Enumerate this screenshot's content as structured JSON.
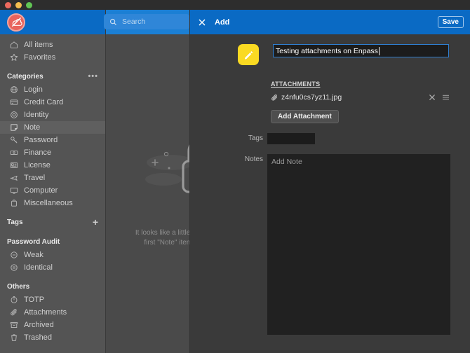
{
  "window": {
    "traffic_lights": [
      "close",
      "minimize",
      "zoom"
    ]
  },
  "search": {
    "placeholder": "Search"
  },
  "sidebar": {
    "logo_name": "enpass-logo",
    "top_items": [
      {
        "label": "All items",
        "icon": "home-icon"
      },
      {
        "label": "Favorites",
        "icon": "star-icon"
      }
    ],
    "categories_header": "Categories",
    "categories_menu": "•••",
    "categories": [
      {
        "label": "Login",
        "icon": "globe-icon",
        "active": false
      },
      {
        "label": "Credit Card",
        "icon": "credit-card-icon",
        "active": false
      },
      {
        "label": "Identity",
        "icon": "identity-icon",
        "active": false
      },
      {
        "label": "Note",
        "icon": "note-icon",
        "active": true
      },
      {
        "label": "Password",
        "icon": "key-icon",
        "active": false
      },
      {
        "label": "Finance",
        "icon": "finance-icon",
        "active": false
      },
      {
        "label": "License",
        "icon": "license-icon",
        "active": false
      },
      {
        "label": "Travel",
        "icon": "travel-icon",
        "active": false
      },
      {
        "label": "Computer",
        "icon": "monitor-icon",
        "active": false
      },
      {
        "label": "Miscellaneous",
        "icon": "briefcase-icon",
        "active": false
      }
    ],
    "tags_header": "Tags",
    "tags_add": "+",
    "password_audit_header": "Password Audit",
    "password_audit": [
      {
        "label": "Weak",
        "icon": "minus-circle-icon"
      },
      {
        "label": "Identical",
        "icon": "equals-circle-icon"
      }
    ],
    "others_header": "Others",
    "others": [
      {
        "label": "TOTP",
        "icon": "timer-icon"
      },
      {
        "label": "Attachments",
        "icon": "paperclip-icon"
      },
      {
        "label": "Archived",
        "icon": "archive-icon"
      },
      {
        "label": "Trashed",
        "icon": "trash-icon"
      }
    ]
  },
  "list_panel": {
    "empty_illustration": "sleeping-padlock-illustration",
    "empty_text": "It looks like a little empty here. Add your first \"Note\" item using the + button"
  },
  "detail": {
    "close_icon": "close-icon",
    "title": "Add",
    "save_label": "Save",
    "item_icon": "pencil-note-icon",
    "title_value": "Testing attachments on Enpass",
    "attachments_label": "ATTACHMENTS",
    "attachments": [
      {
        "name": "z4nfu0cs7yz11.jpg",
        "clip_icon": "paperclip-icon",
        "remove_icon": "close-icon",
        "drag_icon": "drag-handle-icon"
      }
    ],
    "add_attachment_label": "Add Attachment",
    "tags_label": "Tags",
    "tags_value": "",
    "notes_label": "Notes",
    "notes_placeholder": "Add Note"
  },
  "colors": {
    "accent_blue": "#0a6ac4",
    "header_blue": "#1b7fd4",
    "note_yellow": "#fada22",
    "logo_red": "#e8635c",
    "sidebar_bg": "#545454",
    "detail_bg": "#3a3a3a",
    "field_bg": "#1c1c1c"
  }
}
